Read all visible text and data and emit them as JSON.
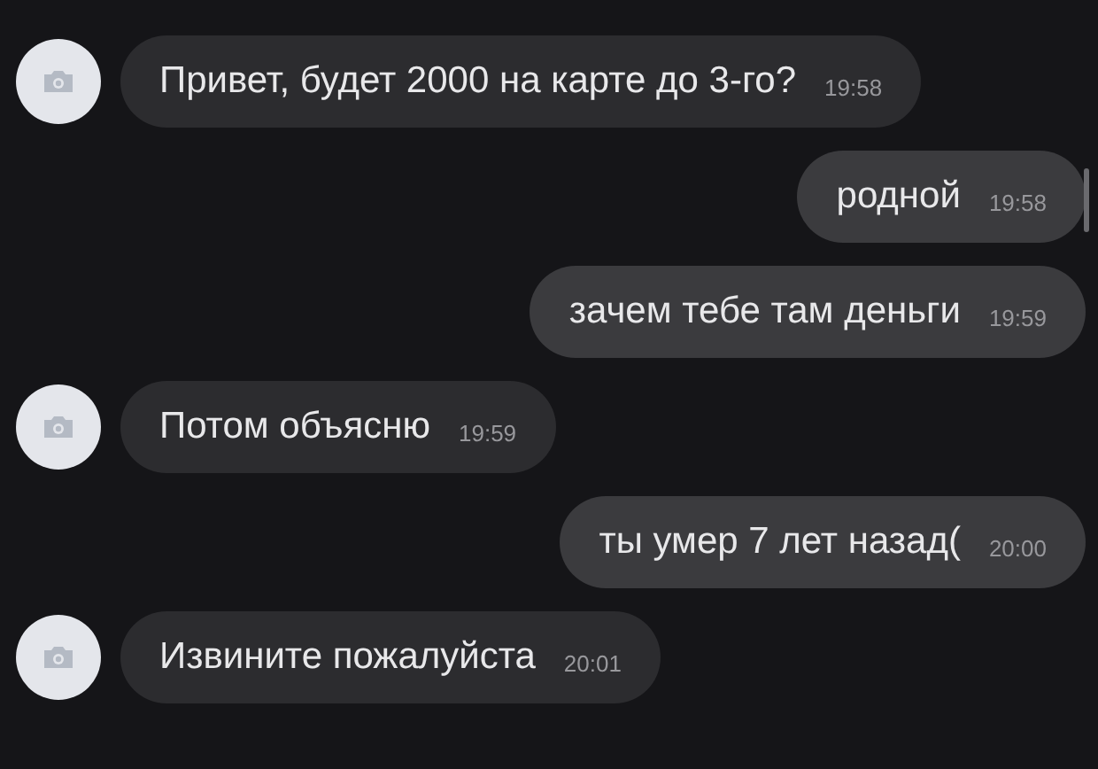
{
  "messages": [
    {
      "kind": "incoming",
      "text": "Привет, будет 2000 на карте до 3-го?",
      "time": "19:58"
    },
    {
      "kind": "outgoing",
      "text": "родной",
      "time": "19:58"
    },
    {
      "kind": "outgoing",
      "text": "зачем тебе там деньги",
      "time": "19:59"
    },
    {
      "kind": "incoming",
      "text": "Потом объясню",
      "time": "19:59"
    },
    {
      "kind": "outgoing",
      "text": "ты умер 7 лет назад(",
      "time": "20:00"
    },
    {
      "kind": "incoming",
      "text": "Извините пожалуйста",
      "time": "20:01"
    }
  ]
}
